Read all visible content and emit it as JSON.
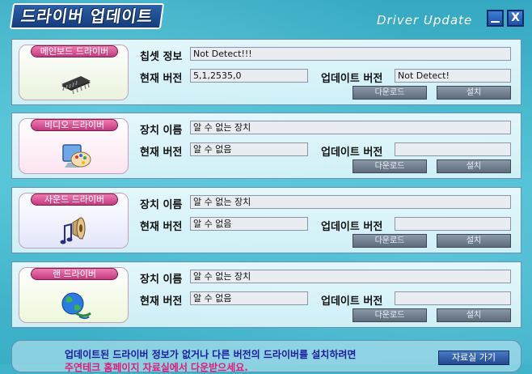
{
  "title_ko": "드라이버 업데이트",
  "title_en": "Driver Update",
  "window_buttons": {
    "minimize": "",
    "close": "X"
  },
  "labels": {
    "chipset_info": "칩셋 정보",
    "device_name": "장치 이름",
    "current_version": "현재 버전",
    "update_version": "업데이트 버전",
    "download": "다운로드",
    "install": "설치"
  },
  "panels": [
    {
      "category": "메인보드 드라이버",
      "icon": "chip-icon",
      "name_label": "칩셋 정보",
      "name_value": "Not Detect!!!",
      "current_version": "5,1,2535,0",
      "update_version": "Not Detect!"
    },
    {
      "category": "비디오 드라이버",
      "icon": "display-palette-icon",
      "name_label": "장치 이름",
      "name_value": "알 수 없는 장치",
      "current_version": "알 수 없음",
      "update_version": ""
    },
    {
      "category": "사운드 드라이버",
      "icon": "speaker-note-icon",
      "name_label": "장치 이름",
      "name_value": "알 수 없는 장치",
      "current_version": "알 수 없음",
      "update_version": ""
    },
    {
      "category": "랜 드라이버",
      "icon": "network-globe-icon",
      "name_label": "장치 이름",
      "name_value": "알 수 없는 장치",
      "current_version": "알 수 없음",
      "update_version": ""
    }
  ],
  "bottom": {
    "line1": "업데이트된 드라이버 정보가 없거나 다른 버전의 드라이버를 설치하려면",
    "line2": "주연테크 홈페이지 자료실에서 다운받으세요.",
    "go_button": "자료실 가기"
  }
}
